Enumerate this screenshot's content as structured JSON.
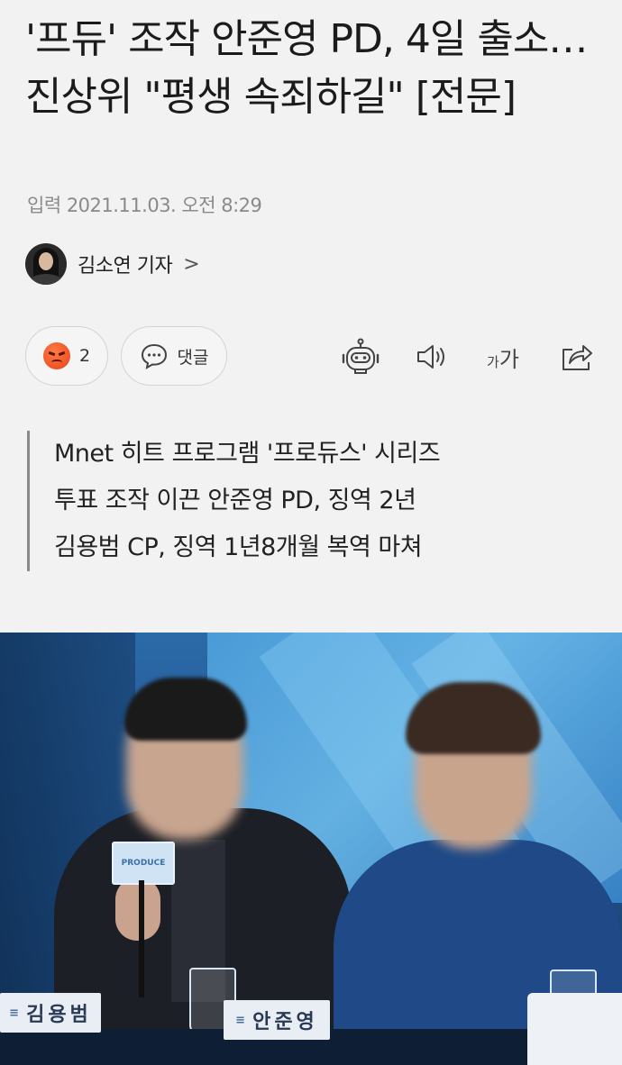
{
  "article": {
    "headline": "'프듀' 조작 안준영 PD, 4일 출소…진상위 \"평생 속죄하길\" [전문]",
    "timestamp": "입력 2021.11.03. 오전 8:29",
    "reporter": "김소연 기자",
    "reporter_chevron": ">"
  },
  "actions": {
    "reaction_count": "2",
    "comment_label": "댓글",
    "font_label_small": "가",
    "font_label_large": "가"
  },
  "summary": {
    "lines": [
      "Mnet 히트 프로그램 '프로듀스' 시리즈",
      "투표 조작 이끈 안준영 PD, 징역 2년",
      "김용범 CP, 징역 1년8개월 복역 마쳐"
    ]
  },
  "photo": {
    "nameplate_left": "김용범",
    "nameplate_right": "안준영",
    "nameplate_mark": "≡"
  },
  "icons": {
    "reaction": "angry-emoji-icon",
    "comment": "speech-bubble-icon",
    "robot": "robot-icon",
    "speaker": "speaker-icon",
    "font": "font-size-icon",
    "share": "share-icon"
  },
  "colors": {
    "background": "#f2f2f2",
    "reaction": "#e8431a",
    "quote_bar": "#8a8a8a"
  }
}
